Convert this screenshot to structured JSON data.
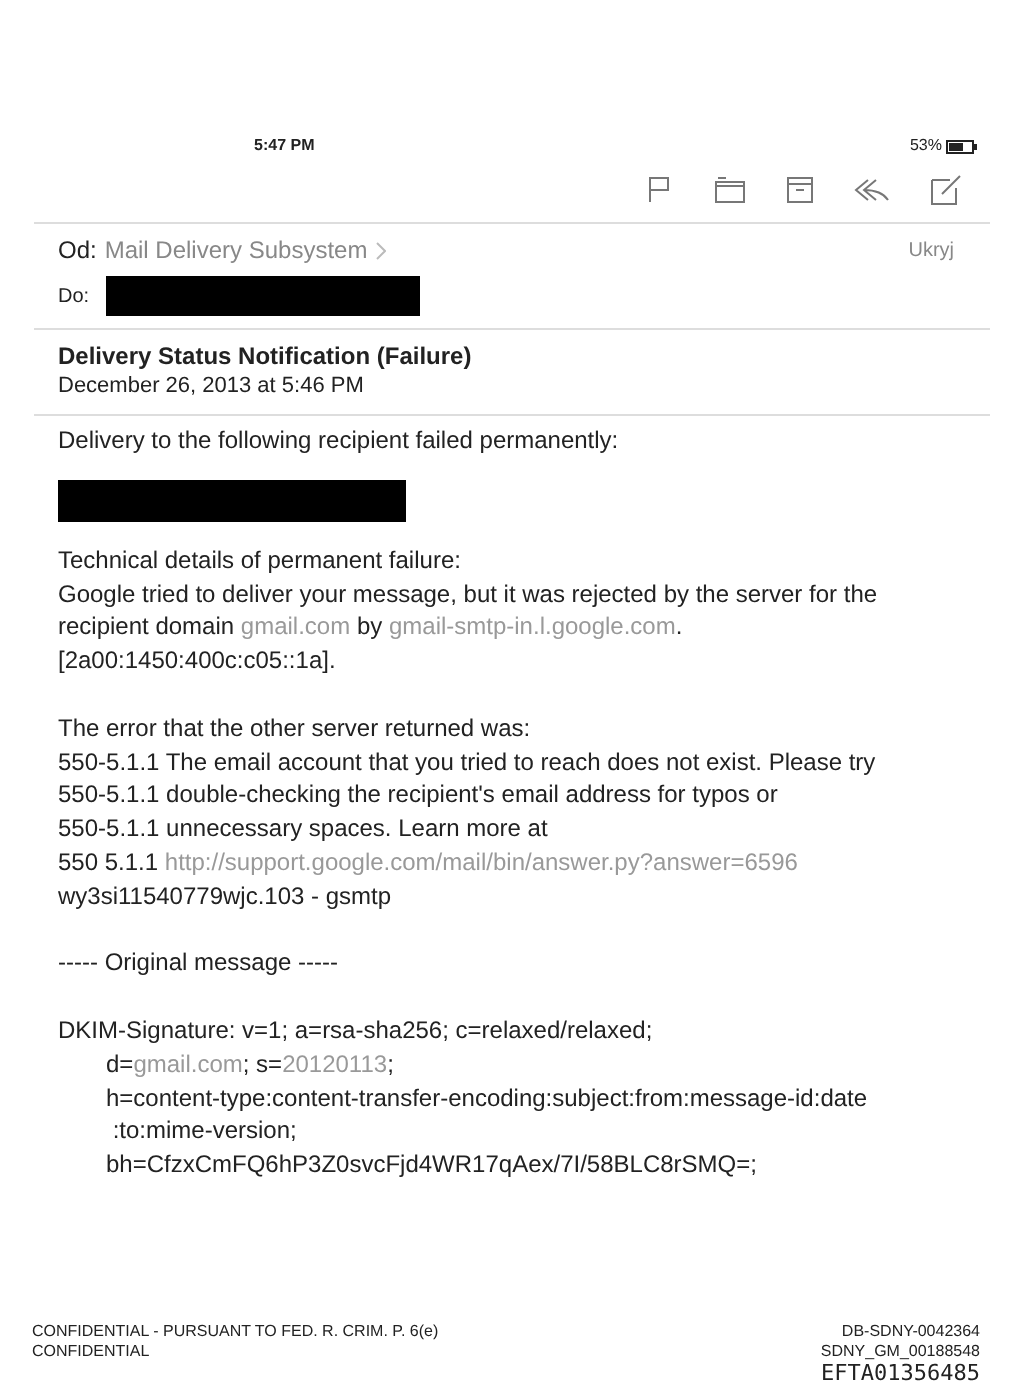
{
  "status_bar": {
    "time": "5:47 PM",
    "battery": "53%"
  },
  "header": {
    "from_label": "Od:",
    "from_name": "Mail Delivery Subsystem",
    "hide_link": "Ukryj",
    "to_label": "Do:",
    "to_redacted": true
  },
  "message": {
    "subject": "Delivery Status Notification (Failure)",
    "date": "December 26, 2013 at 5:46 PM"
  },
  "body": [
    {
      "kind": "line",
      "segments": [
        {
          "kind": "text",
          "text": "Delivery to the following recipient failed permanently:"
        }
      ]
    },
    {
      "kind": "redaction"
    },
    {
      "kind": "line",
      "segments": [
        {
          "kind": "text",
          "text": "Technical details of permanent failure:"
        }
      ]
    },
    {
      "kind": "line",
      "segments": [
        {
          "kind": "text",
          "text": "Google tried to deliver your message, but it was rejected by the server for the"
        }
      ]
    },
    {
      "kind": "line",
      "segments": [
        {
          "kind": "text",
          "text": "recipient domain"
        },
        {
          "kind": "link",
          "text": "gmail.com"
        },
        {
          "kind": "text",
          "text": "by"
        },
        {
          "kind": "link",
          "text": "gmail-smtp-in.l.google.com"
        },
        {
          "kind": "text",
          "text": "."
        }
      ]
    },
    {
      "kind": "line",
      "segments": [
        {
          "kind": "text",
          "text": "[2a00:1450:400c:c05::1a]."
        }
      ]
    },
    {
      "kind": "gap"
    },
    {
      "kind": "line",
      "segments": [
        {
          "kind": "text",
          "text": "The error that the other server returned was:"
        }
      ]
    },
    {
      "kind": "line",
      "segments": [
        {
          "kind": "text",
          "text": "550-5.1.1 The email account that you tried to reach does not exist. Please try"
        }
      ]
    },
    {
      "kind": "line",
      "segments": [
        {
          "kind": "text",
          "text": "550-5.1.1 double-checking the recipient's email address for typos or"
        }
      ]
    },
    {
      "kind": "line",
      "segments": [
        {
          "kind": "text",
          "text": "550-5.1.1 unnecessary spaces. Learn more at"
        }
      ]
    },
    {
      "kind": "line",
      "segments": [
        {
          "kind": "text",
          "text": "550 5.1.1"
        },
        {
          "kind": "link",
          "text": "http://support.google.com/mail/bin/answer.py?answer=6596"
        }
      ]
    },
    {
      "kind": "line",
      "segments": [
        {
          "kind": "text",
          "text": "wy3si11540779wjc.103 - gsmtp"
        }
      ]
    },
    {
      "kind": "gap"
    },
    {
      "kind": "line",
      "segments": [
        {
          "kind": "text",
          "text": "----- Original message -----"
        }
      ]
    },
    {
      "kind": "gap"
    },
    {
      "kind": "line",
      "segments": [
        {
          "kind": "text",
          "text": "DKIM-Signature: v=1; a=rsa-sha256; c=relaxed/relaxed;"
        }
      ]
    },
    {
      "kind": "indented",
      "segments": [
        {
          "kind": "text",
          "text": "d="
        },
        {
          "kind": "link",
          "text": "gmail.com"
        },
        {
          "kind": "text",
          "text": "; s="
        },
        {
          "kind": "link",
          "text": "20120113"
        },
        {
          "kind": "text",
          "text": ";"
        }
      ]
    },
    {
      "kind": "indented",
      "segments": [
        {
          "kind": "text",
          "text": "h=content-type:content-transfer-encoding:subject:from:message-id:date"
        }
      ]
    },
    {
      "kind": "indented",
      "segments": [
        {
          "kind": "text",
          "text": " :to:mime-version;"
        }
      ]
    },
    {
      "kind": "indented",
      "segments": [
        {
          "kind": "text",
          "text": "bh=CfzxCmFQ6hP3Z0svcFjd4WR17qAex/7I/58BLC8rSMQ=;"
        }
      ]
    }
  ],
  "footer": {
    "left": [
      "CONFIDENTIAL - PURSUANT TO FED. R. CRIM. P. 6(e)",
      "CONFIDENTIAL"
    ],
    "right": [
      "DB-SDNY-0042364",
      "SDNY_GM_00188548"
    ],
    "stamp": "EFTA01356485"
  }
}
